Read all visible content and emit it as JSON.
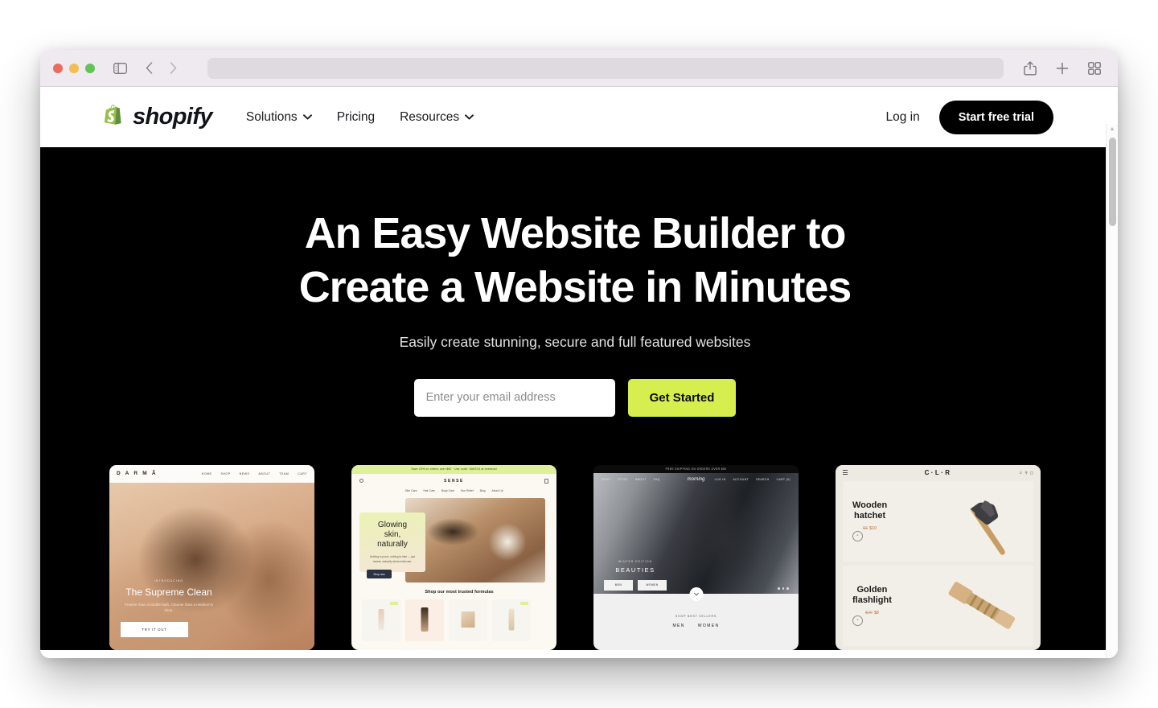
{
  "browser": {
    "traffic_lights": [
      "close",
      "minimize",
      "zoom"
    ],
    "sidebar_icon": "sidebar-toggle-icon",
    "back_label": "‹",
    "forward_label": "›",
    "url_value": "",
    "url_placeholder": "",
    "share_icon": "share-icon",
    "new_tab_icon": "plus-icon",
    "tab_overview_icon": "tab-overview-icon"
  },
  "header": {
    "brand": "shopify",
    "nav": [
      {
        "label": "Solutions",
        "has_chevron": true
      },
      {
        "label": "Pricing",
        "has_chevron": false
      },
      {
        "label": "Resources",
        "has_chevron": true
      }
    ],
    "login_label": "Log in",
    "trial_label": "Start free trial"
  },
  "hero": {
    "title_line1": "An Easy Website Builder to",
    "title_line2": "Create a Website in Minutes",
    "subtitle": "Easily create stunning, secure and full featured websites",
    "email_placeholder": "Enter your email address",
    "email_value": "",
    "cta_label": "Get Started",
    "background": "#000000",
    "cta_color": "#d6ef4e"
  },
  "showcase": {
    "cards": [
      {
        "id": "darma",
        "brand": "D A R M Ã",
        "nav": [
          "HOME",
          "SHOP",
          "NEWS",
          "ABOUT",
          "TEAM",
          "CART"
        ],
        "eyebrow": "INTRODUCING",
        "headline": "The Supreme Clean",
        "description": "Fresher than a bubble bath. Cleaner than a newborn's shoe.",
        "button": "TRY IT OUT"
      },
      {
        "id": "sense",
        "announcement": "Save 15% on orders over $60 · Use code: SAVE15 at checkout",
        "brand": "SENSE",
        "nav": [
          "Skin Care",
          "Hair Care",
          "Body Care",
          "Sun Relief",
          "Blog",
          "About Us"
        ],
        "headline_line1": "Glowing",
        "headline_line2": "skin,",
        "headline_line3": "naturally",
        "description": "Nothing to prove, nothing to hide — just honest, naturally derived skincare.",
        "button": "Shop now",
        "section_title": "Shop our most trusted formulas",
        "product_tags": [
          "SALE",
          "NEW"
        ]
      },
      {
        "id": "fashion",
        "announcement": "FREE SHIPPING ON ORDERS OVER $50",
        "brand": "morning",
        "nav_left": [
          "SHOP",
          "STYLE",
          "ABOUT",
          "FAQ"
        ],
        "nav_right": [
          "LOG IN",
          "ACCOUNT",
          "SEARCH",
          "CART (0)"
        ],
        "eyebrow": "WINTER EDITION",
        "headline": "BEAUTIES",
        "buttons": [
          "MEN",
          "WOMEN"
        ],
        "lower_title": "SHOP BEST SELLERS",
        "lower_nav": [
          "MEN",
          "WOMEN"
        ]
      },
      {
        "id": "clr",
        "brand": "C·L·R",
        "products": [
          {
            "name_line1": "Wooden",
            "name_line2": "hatchet",
            "old_price": "$6",
            "price": "$10",
            "button": "Add to cart"
          },
          {
            "name_line1": "Golden",
            "name_line2": "flashlight",
            "old_price": "$20",
            "price": "$8",
            "button": "Add to cart"
          }
        ]
      }
    ]
  },
  "scrollbar": {
    "up_arrow": "▲",
    "down_arrow": "▼"
  }
}
